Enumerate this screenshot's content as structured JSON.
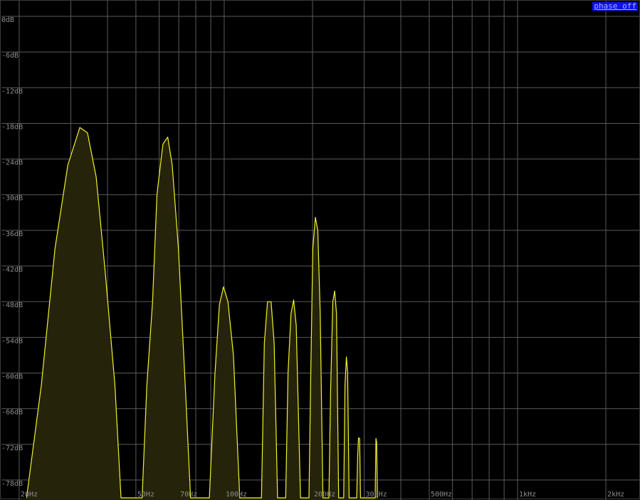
{
  "controls": {
    "phase_label": "phase off"
  },
  "chart_data": {
    "type": "area",
    "xscale": "log",
    "x_unit": "Hz",
    "y_unit": "dB",
    "ylim": [
      -81,
      0
    ],
    "xlim": [
      17.4,
      2600
    ],
    "grid": true,
    "y_ticks": [
      {
        "value": 0,
        "label": "0dB"
      },
      {
        "value": -6,
        "label": "-6dB"
      },
      {
        "value": -12,
        "label": "-12dB"
      },
      {
        "value": -18,
        "label": "-18dB"
      },
      {
        "value": -24,
        "label": "-24dB"
      },
      {
        "value": -30,
        "label": "-30dB"
      },
      {
        "value": -36,
        "label": "-36dB"
      },
      {
        "value": -42,
        "label": "-42dB"
      },
      {
        "value": -48,
        "label": "-48dB"
      },
      {
        "value": -54,
        "label": "-54dB"
      },
      {
        "value": -60,
        "label": "-60dB"
      },
      {
        "value": -66,
        "label": "-66dB"
      },
      {
        "value": -72,
        "label": "-72dB"
      },
      {
        "value": -78,
        "label": "-78dB"
      }
    ],
    "x_ticks": [
      {
        "value": 20,
        "label": "20Hz"
      },
      {
        "value": 50,
        "label": "50Hz"
      },
      {
        "value": 70,
        "label": "70Hz"
      },
      {
        "value": 100,
        "label": "100Hz"
      },
      {
        "value": 200,
        "label": "200Hz"
      },
      {
        "value": 300,
        "label": "300Hz"
      },
      {
        "value": 500,
        "label": "500Hz"
      },
      {
        "value": 1000,
        "label": "1kHz"
      },
      {
        "value": 2000,
        "label": "2kHz"
      }
    ],
    "x_gridlines": [
      20,
      30,
      40,
      50,
      60,
      70,
      80,
      90,
      100,
      200,
      300,
      400,
      500,
      600,
      700,
      800,
      900,
      1000,
      2000
    ],
    "colors": {
      "line": "#f2f22a",
      "fill": "#25240a",
      "grid": "#5a5a5a",
      "label": "#8c8c8c",
      "background": "#000000"
    },
    "series": [
      {
        "points": [
          [
            21.2,
            -81
          ],
          [
            23.8,
            -62
          ],
          [
            26.5,
            -39
          ],
          [
            29.3,
            -25
          ],
          [
            32.2,
            -18.7
          ],
          [
            34.2,
            -19.6
          ],
          [
            36.6,
            -27
          ],
          [
            39.3,
            -43
          ],
          [
            42.4,
            -62
          ],
          [
            44.5,
            -81
          ],
          [
            52.5,
            -81
          ],
          [
            54.5,
            -62
          ],
          [
            57.0,
            -48
          ],
          [
            59.0,
            -30
          ],
          [
            61.8,
            -21.5
          ],
          [
            64.2,
            -20.3
          ],
          [
            66.5,
            -25
          ],
          [
            69.8,
            -39
          ],
          [
            73.8,
            -63
          ],
          [
            76.8,
            -81
          ],
          [
            89.0,
            -81
          ],
          [
            93.0,
            -60
          ],
          [
            96.3,
            -48.5
          ],
          [
            99.5,
            -45.5
          ],
          [
            103,
            -48
          ],
          [
            107.5,
            -57
          ],
          [
            113,
            -81
          ],
          [
            134,
            -81
          ],
          [
            137,
            -55
          ],
          [
            140.5,
            -48
          ],
          [
            144.5,
            -48
          ],
          [
            148,
            -55
          ],
          [
            152,
            -81
          ],
          [
            162,
            -81
          ],
          [
            165,
            -60
          ],
          [
            169,
            -50
          ],
          [
            172.5,
            -47.7
          ],
          [
            176,
            -52
          ],
          [
            182,
            -81
          ],
          [
            194.5,
            -81
          ],
          [
            197,
            -62
          ],
          [
            200.5,
            -39
          ],
          [
            204.5,
            -33.8
          ],
          [
            208.5,
            -36
          ],
          [
            212.5,
            -50
          ],
          [
            217,
            -81
          ],
          [
            227.5,
            -81
          ],
          [
            230.5,
            -63
          ],
          [
            234.5,
            -48
          ],
          [
            238,
            -46.2
          ],
          [
            241.5,
            -50
          ],
          [
            245.5,
            -81
          ],
          [
            255.5,
            -81
          ],
          [
            258,
            -62
          ],
          [
            261,
            -57.3
          ],
          [
            263.5,
            -60
          ],
          [
            266.5,
            -81
          ],
          [
            283,
            -81
          ],
          [
            285,
            -74
          ],
          [
            287,
            -70.9
          ],
          [
            289.5,
            -71
          ],
          [
            291.5,
            -81
          ],
          [
            327,
            -81
          ],
          [
            329,
            -71
          ],
          [
            331,
            -71.7
          ],
          [
            333,
            -81
          ]
        ]
      }
    ]
  }
}
